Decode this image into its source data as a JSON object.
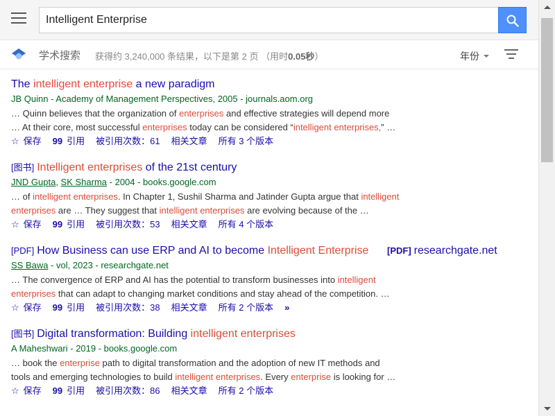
{
  "header": {
    "search_value": "Intelligent Enterprise",
    "menu_icon": "hamburger-menu-icon",
    "search_icon": "search-icon",
    "search_button_color": "#4d90fe"
  },
  "subbar": {
    "title": "学术搜索",
    "stats_prefix": "获得约 3,240,000 条结果，以下是第 2 页 （用时",
    "stats_time": "0.05秒",
    "stats_suffix": "）",
    "year_label": "年份",
    "filter_icon": "filter-icon",
    "logo_icon": "scholar-logo-icon"
  },
  "results": [
    {
      "tag": "",
      "title_parts": [
        "The ",
        "intelligent enterprise",
        " a new paradigm"
      ],
      "meta": "JB Quinn - Academy of Management Perspectives, 2005 - journals.aom.org",
      "snippet_line1": [
        "… Quinn believes that the organization of ",
        "enterprises",
        " and effective strategies will depend more"
      ],
      "snippet_line2": [
        "… At their core, most successful ",
        "enterprises",
        " today can be considered “",
        "intelligent enterprises,",
        "” …"
      ],
      "save": "保存",
      "cite": "引用",
      "cited_by": "被引用次数：61",
      "related": "相关文章",
      "versions": "所有 3 个版本"
    },
    {
      "tag": "[图书]",
      "title_parts": [
        "Intelligent enterprises",
        " of the 21st century"
      ],
      "author1": "JND Gupta",
      "author_sep": ", ",
      "author2": "SK Sharma",
      "meta_rest": " - 2004 - books.google.com",
      "snippet_line1": [
        "… of ",
        "intelligent enterprises",
        ". In Chapter 1, Sushil Sharma and Jatinder Gupta argue that ",
        "intelligent"
      ],
      "snippet_line2": [
        "enterprises",
        " are … They suggest that ",
        "intelligent enterprises",
        " are evolving because of the …"
      ],
      "save": "保存",
      "cite": "引用",
      "cited_by": "被引用次数：53",
      "related": "相关文章",
      "versions": "所有 4 个版本"
    },
    {
      "tag": "[PDF]",
      "title_parts": [
        "How Business can use ERP and AI to become ",
        "Intelligent Enterprise"
      ],
      "author1": "SS Bawa",
      "meta_rest": " - vol, 2023 - researchgate.net",
      "side_pdf": "[PDF]",
      "side_domain": "researchgate.net",
      "snippet_line1": [
        "… The convergence of ERP and AI has the potential to transform businesses into ",
        "intelligent"
      ],
      "snippet_line2": [
        "enterprises",
        " that can adapt to changing market conditions and stay ahead of the competition. …"
      ],
      "save": "保存",
      "cite": "引用",
      "cited_by": "被引用次数：38",
      "related": "相关文章",
      "versions": "所有 2 个版本",
      "more": "»"
    },
    {
      "tag": "[图书]",
      "title_parts": [
        "Digital transformation: Building ",
        "intelligent enterprises"
      ],
      "meta": "A Maheshwari - 2019 - books.google.com",
      "snippet_line1": [
        "… book the ",
        "enterprise",
        " path to digital transformation and the adoption of new IT methods and"
      ],
      "snippet_line2": [
        "tools and emerging technologies to build ",
        "intelligent enterprises",
        ". Every ",
        "enterprise",
        " is looking for …"
      ],
      "save": "保存",
      "cite": "引用",
      "cited_by": "被引用次数：86",
      "related": "相关文章",
      "versions": "所有 2 个版本"
    }
  ],
  "colors": {
    "link": "#1a0dab",
    "highlight": "#dd4b39",
    "meta": "#006621"
  }
}
